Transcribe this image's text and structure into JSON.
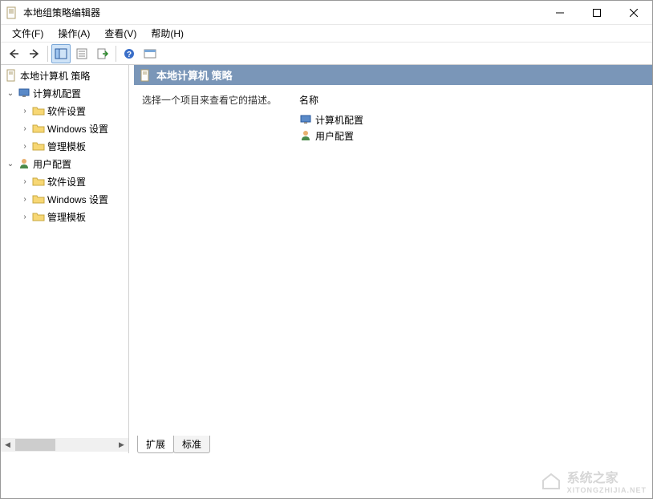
{
  "window": {
    "title": "本地组策略编辑器"
  },
  "menu": {
    "file": "文件(F)",
    "action": "操作(A)",
    "view": "查看(V)",
    "help": "帮助(H)"
  },
  "tree": {
    "root": "本地计算机 策略",
    "computer_config": "计算机配置",
    "software_settings1": "软件设置",
    "windows_settings1": "Windows 设置",
    "admin_templates1": "管理模板",
    "user_config": "用户配置",
    "software_settings2": "软件设置",
    "windows_settings2": "Windows 设置",
    "admin_templates2": "管理模板"
  },
  "content": {
    "header": "本地计算机 策略",
    "description": "选择一个项目来查看它的描述。",
    "name_column": "名称",
    "items": {
      "computer": "计算机配置",
      "user": "用户配置"
    }
  },
  "tabs": {
    "extended": "扩展",
    "standard": "标准"
  },
  "watermark": {
    "main": "系统之家",
    "sub": "XITONGZHIJIA.NET"
  }
}
